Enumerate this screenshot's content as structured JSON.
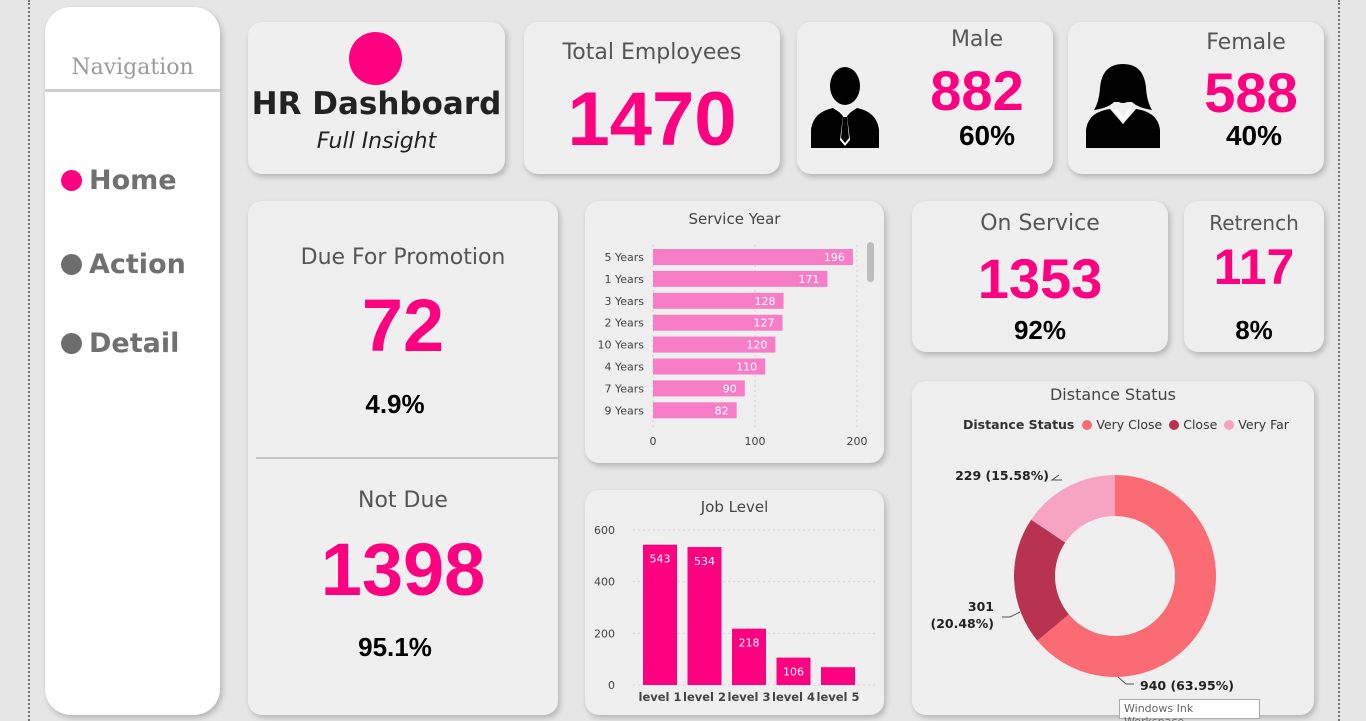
{
  "nav": {
    "title": "Navigation",
    "items": [
      {
        "label": "Home",
        "color": "#ff0080"
      },
      {
        "label": "Action",
        "color": "#6d6d6d"
      },
      {
        "label": "Detail",
        "color": "#6d6d6d"
      }
    ]
  },
  "header": {
    "title": "HR Dashboard",
    "subtitle": "Full Insight"
  },
  "total": {
    "label": "Total Employees",
    "value": "1470"
  },
  "male": {
    "label": "Male",
    "value": "882",
    "pct": "60%",
    "icon": "man-silhouette-icon"
  },
  "female": {
    "label": "Female",
    "value": "588",
    "pct": "40%",
    "icon": "woman-silhouette-icon"
  },
  "promotion": {
    "due_label": "Due For Promotion",
    "due_value": "72",
    "due_pct": "4.9%",
    "notdue_label": "Not Due",
    "notdue_value": "1398",
    "notdue_pct": "95.1%"
  },
  "on_service": {
    "label": "On Service",
    "value": "1353",
    "pct": "92%"
  },
  "retrench": {
    "label": "Retrench",
    "value": "117",
    "pct": "8%"
  },
  "service_year": {
    "title": "Service Year",
    "categories": [
      "5 Years",
      "1 Years",
      "3 Years",
      "2 Years",
      "10 Years",
      "4 Years",
      "7 Years",
      "9 Years"
    ],
    "values": [
      196,
      171,
      128,
      127,
      120,
      110,
      90,
      82
    ],
    "ticks": [
      "0",
      "100",
      "200"
    ],
    "xlim": [
      0,
      200
    ],
    "color": "#f77ec6"
  },
  "job_level": {
    "title": "Job Level",
    "categories": [
      "level 1",
      "level 2",
      "level 3",
      "level 4",
      "level 5"
    ],
    "values": [
      543,
      534,
      218,
      106,
      69
    ],
    "labels": [
      "543",
      "534",
      "218",
      "106",
      ""
    ],
    "ticks": [
      "0",
      "200",
      "400",
      "600"
    ],
    "ylim": [
      0,
      600
    ],
    "color": "#ff0080"
  },
  "distance": {
    "title": "Distance Status",
    "legend_title": "Distance Status",
    "slices": [
      {
        "name": "Very Close",
        "value": 940,
        "label": "940 (63.95%)",
        "color": "#fb6b74"
      },
      {
        "name": "Close",
        "value": 301,
        "label": "301 (20.48%)",
        "color": "#b8334f"
      },
      {
        "name": "Very Far",
        "value": 229,
        "label": "229 (15.58%)",
        "color": "#f7a4c2"
      }
    ]
  },
  "status_bar": {
    "text": "Windows Ink Workspace"
  },
  "chart_data": [
    {
      "type": "bar",
      "title": "Service Year",
      "orientation": "horizontal",
      "categories": [
        "5 Years",
        "1 Years",
        "3 Years",
        "2 Years",
        "10 Years",
        "4 Years",
        "7 Years",
        "9 Years"
      ],
      "values": [
        196,
        171,
        128,
        127,
        120,
        110,
        90,
        82
      ],
      "xlim": [
        0,
        200
      ]
    },
    {
      "type": "bar",
      "title": "Job Level",
      "categories": [
        "level 1",
        "level 2",
        "level 3",
        "level 4",
        "level 5"
      ],
      "values": [
        543,
        534,
        218,
        106,
        69
      ],
      "ylim": [
        0,
        600
      ]
    },
    {
      "type": "pie",
      "title": "Distance Status",
      "categories": [
        "Very Close",
        "Close",
        "Very Far"
      ],
      "values": [
        940,
        301,
        229
      ],
      "labels": [
        "940 (63.95%)",
        "301 (20.48%)",
        "229 (15.58%)"
      ],
      "legend": "top"
    }
  ]
}
